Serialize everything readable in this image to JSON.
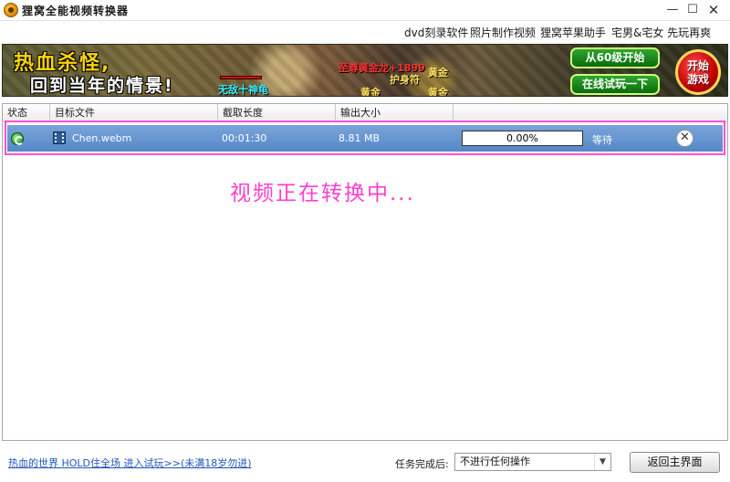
{
  "window": {
    "title": "狸窝全能视频转换器",
    "controls": {
      "minimize": "—",
      "maximize": "☐",
      "close": "✕"
    }
  },
  "menu": {
    "items": [
      "dvd刻录软件",
      "照片制作视频",
      "狸窝苹果助手",
      "宅男&宅女 先玩再爽"
    ]
  },
  "banner": {
    "headline_1": "热血杀怪,",
    "headline_2": "回到当年的情景!",
    "game_texts": [
      "无敌十神龟",
      "至尊黄金龙+1899",
      "护身符",
      "黄金",
      "黄金",
      "黄金"
    ],
    "button_level": "从60级开始",
    "button_trial": "在线试玩一下",
    "start_button": "开始游戏",
    "colors": {
      "headline_1": "#ffd400",
      "buttons": "#0b6a0b",
      "start": "#c00000"
    }
  },
  "table": {
    "columns": [
      "状态",
      "目标文件",
      "截取长度",
      "输出大小",
      ""
    ],
    "rows": [
      {
        "status_icon": "convert-status-icon",
        "file_icon": "film-icon",
        "file": "Chen.webm",
        "duration": "00:01:30",
        "size": "8.81 MB",
        "progress_text": "0.00%",
        "progress": 0.0,
        "state": "等待",
        "remove": "✕"
      }
    ],
    "highlight_color": "#ff4fd4"
  },
  "overlay": {
    "text": "视频正在转换中...",
    "color": "#ff3fcf"
  },
  "footer": {
    "promo_link": "热血的世界 HOLD住全场 进入试玩>>(未满18岁勿进)",
    "after_label": "任务完成后:",
    "after_select": "不进行任何操作",
    "home_button": "返回主界面"
  }
}
